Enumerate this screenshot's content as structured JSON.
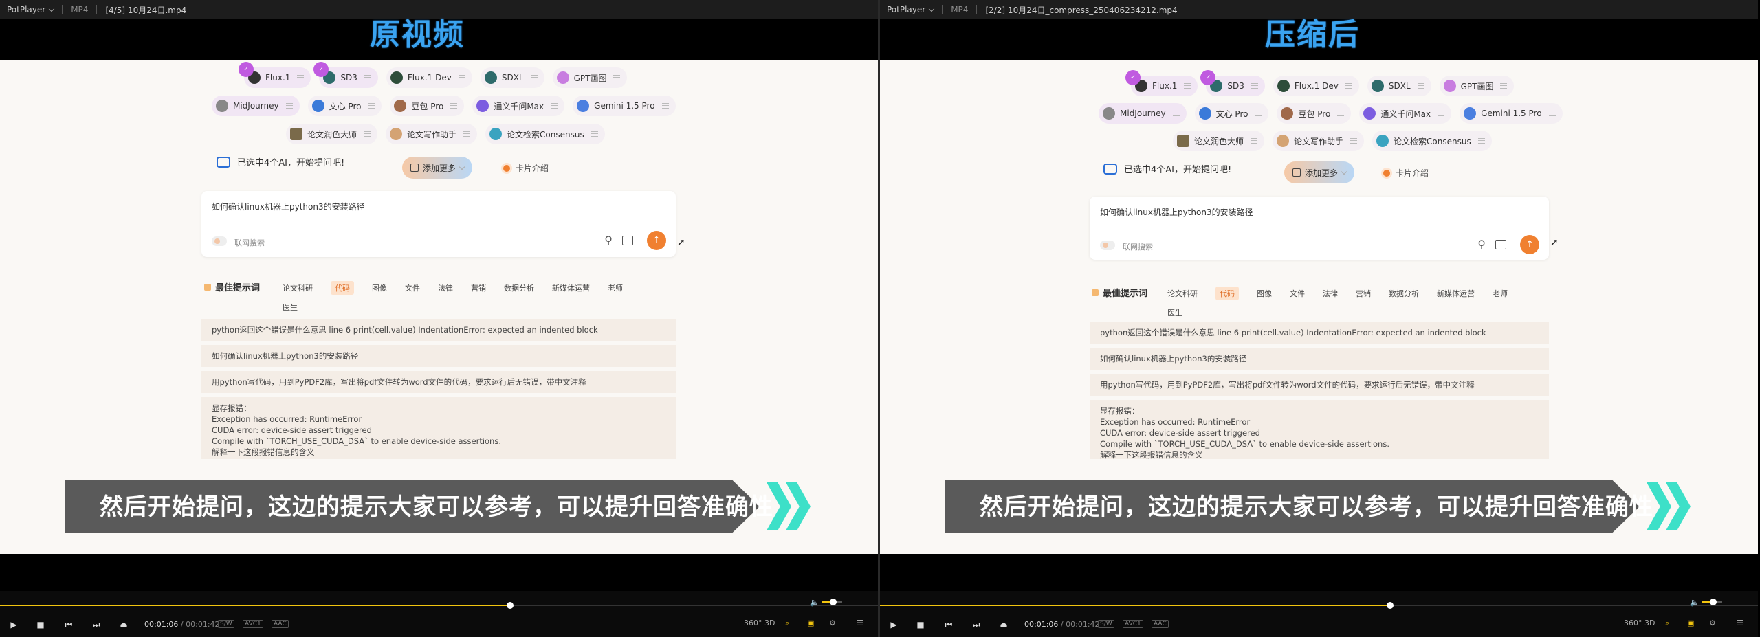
{
  "left": {
    "app": "PotPlayer",
    "format": "MP4",
    "filename": "[4/5] 10月24日.mp4",
    "overlay_title": "原视频",
    "time_current": "00:01:06",
    "time_sep": "/",
    "time_total": "00:01:42",
    "tags": [
      "S/W",
      "AVC1",
      "AAC"
    ],
    "progress": 0.59,
    "volume": 0.55
  },
  "right": {
    "app": "PotPlayer",
    "format": "MP4",
    "filename": "[2/2] 10月24日_compress_250406234212.mp4",
    "overlay_title": "压缩后",
    "time_current": "00:01:06",
    "time_sep": "/",
    "time_total": "00:01:42",
    "tags": [
      "S/W",
      "AVC1",
      "AAC"
    ],
    "progress": 0.59,
    "volume": 0.55
  },
  "models_row1": [
    "Flux.1",
    "SD3",
    "Flux.1 Dev",
    "SDXL",
    "GPT画图"
  ],
  "models_row2": [
    "MidJourney",
    "文心 Pro",
    "豆包 Pro",
    "通义千问Max",
    "Gemini 1.5 Pro"
  ],
  "models_row3": [
    "论文润色大师",
    "论文写作助手",
    "论文检索Consensus"
  ],
  "selected_status": "已选中4个AI，开始提问吧!",
  "add_more": "添加更多",
  "card_intro": "卡片介绍",
  "query": "如何确认linux机器上python3的安装路径",
  "web_search": "联网搜索",
  "tips_title": "最佳提示词",
  "categories": [
    "论文科研",
    "代码",
    "图像",
    "文件",
    "法律",
    "营销",
    "数据分析",
    "新媒体运营",
    "老师",
    "医生"
  ],
  "active_category": "代码",
  "tips": [
    "python返回这个错误是什么意思  line 6 print(cell.value) IndentationError: expected an indented block",
    "如何确认linux机器上python3的安装路径",
    "用python写代码，用到PyPDF2库，写出将pdf文件转为word文件的代码，要求运行后无错误，带中文注释"
  ],
  "tip4": [
    "显存报错：",
    "Exception has occurred: RuntimeError",
    "CUDA error: device-side assert triggered",
    "Compile with `TORCH_USE_CUDA_DSA` to enable device-side assertions.",
    "解释一下这段报错信息的含义"
  ],
  "subtitle": "然后开始提问，这边的提示大家可以参考，可以提升回答准确性",
  "right_icons": [
    "360°",
    "3D"
  ],
  "colors": {
    "accent": "#f08030",
    "overlay_title": "#3aa3f0",
    "seek": "#f1c40f",
    "chevron": "#3de0c8"
  }
}
